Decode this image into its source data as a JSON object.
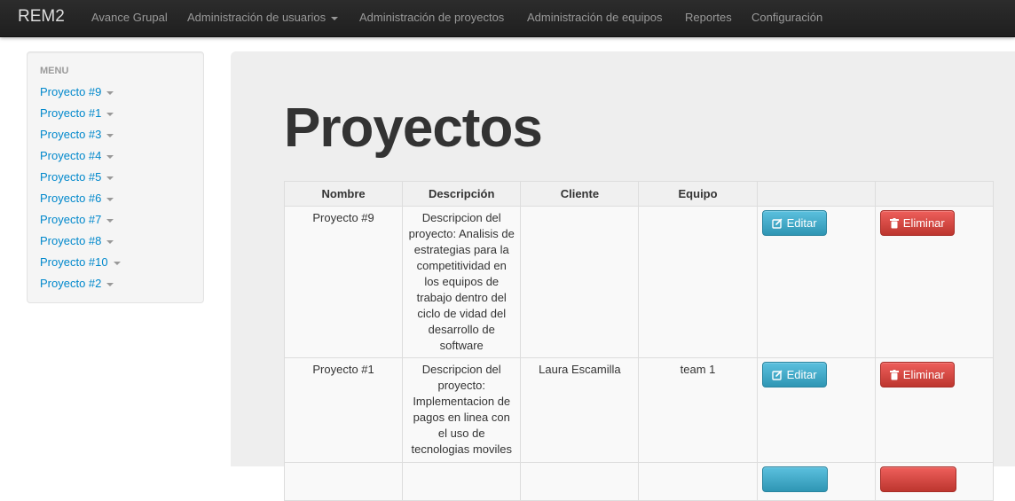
{
  "navbar": {
    "brand": "REM2",
    "items": [
      {
        "label": "Avance Grupal"
      },
      {
        "label": "Administración de usuarios"
      },
      {
        "label": "Administración de proyectos"
      },
      {
        "label": "Administración de equipos"
      },
      {
        "label": "Reportes"
      },
      {
        "label": "Configuración"
      }
    ]
  },
  "sidebar": {
    "header": "MENU",
    "items": [
      {
        "label": "Proyecto #9"
      },
      {
        "label": "Proyecto #1"
      },
      {
        "label": "Proyecto #3"
      },
      {
        "label": "Proyecto #4"
      },
      {
        "label": "Proyecto #5"
      },
      {
        "label": "Proyecto #6"
      },
      {
        "label": "Proyecto #7"
      },
      {
        "label": "Proyecto #8"
      },
      {
        "label": "Proyecto #10"
      },
      {
        "label": "Proyecto #2"
      }
    ]
  },
  "main": {
    "title": "Proyectos",
    "table": {
      "headers": [
        "Nombre",
        "Descripción",
        "Cliente",
        "Equipo",
        "",
        ""
      ],
      "rows": [
        {
          "nombre": "Proyecto #9",
          "descripcion": "Descripcion del proyecto: Analisis de estrategias para la competitividad en los equipos de trabajo dentro del ciclo de vidad del desarrollo de software",
          "cliente": "",
          "equipo": "",
          "edit_label": "Editar",
          "delete_label": "Eliminar"
        },
        {
          "nombre": "Proyecto #1",
          "descripcion": "Descripcion del proyecto: Implementacion de pagos en linea con el uso de tecnologias moviles",
          "cliente": "Laura Escamilla",
          "equipo": "team 1",
          "edit_label": "Editar",
          "delete_label": "Eliminar"
        }
      ]
    }
  },
  "colors": {
    "link": "#0088cc",
    "edit_button": "#2f96b4",
    "delete_button": "#bd362f",
    "navbar": "#222222"
  },
  "icons": {
    "edit": "edit-icon",
    "delete": "trash-icon"
  }
}
